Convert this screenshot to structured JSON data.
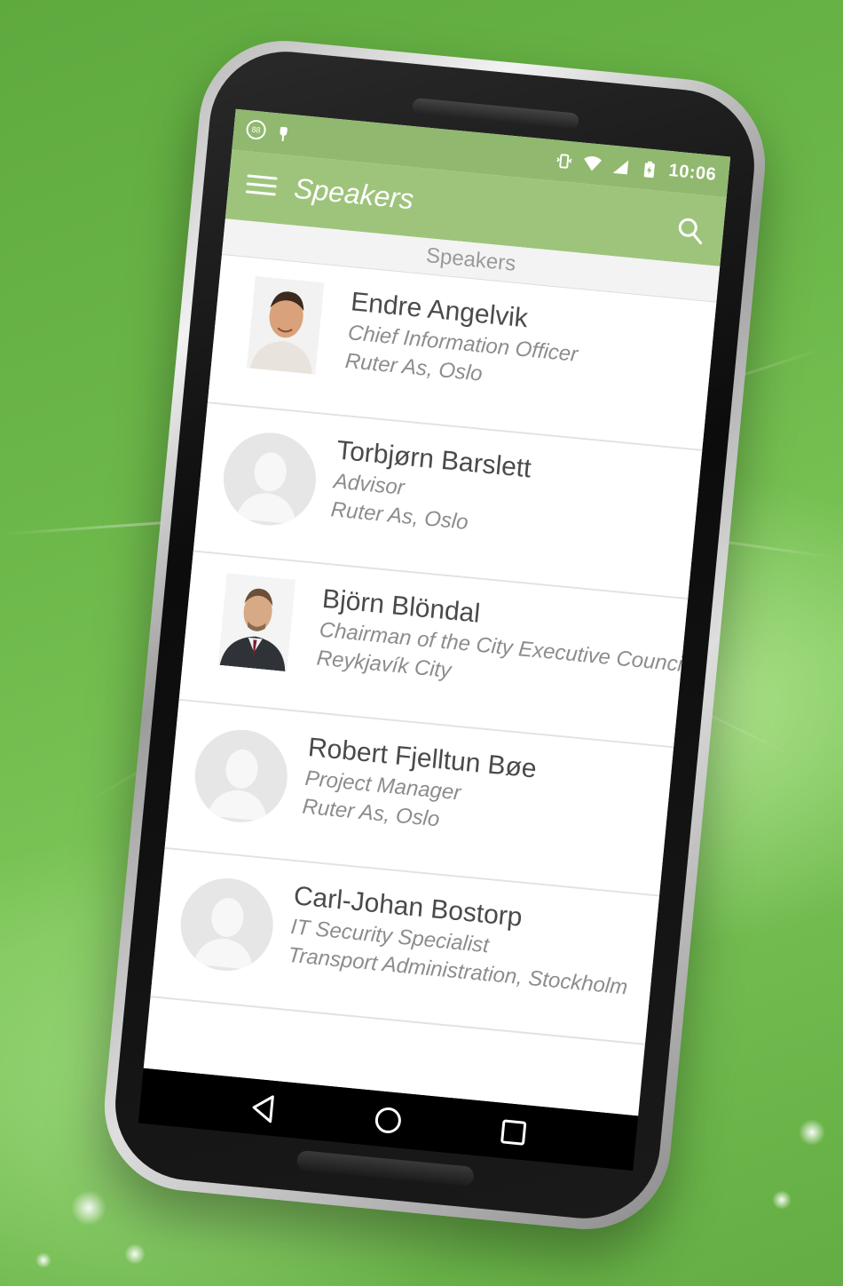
{
  "status_bar": {
    "time": "10:06",
    "icons": [
      "notification-icon",
      "usb-icon",
      "vibrate-icon",
      "wifi-icon",
      "signal-icon",
      "battery-icon"
    ]
  },
  "app_bar": {
    "title": "Speakers",
    "menu_icon": "menu-icon",
    "search_icon": "search-icon",
    "color": "#9ec47c"
  },
  "section_header": "Speakers",
  "speakers": [
    {
      "name": "Endre Angelvik",
      "role": "Chief Information Officer",
      "org": "Ruter As, Oslo",
      "avatar": "photo"
    },
    {
      "name": "Torbjørn Barslett",
      "role": "Advisor",
      "org": "Ruter As, Oslo",
      "avatar": "placeholder"
    },
    {
      "name": "Björn Blöndal",
      "role": "Chairman of the City Executive Council",
      "org": "Reykjavík City",
      "avatar": "photo"
    },
    {
      "name": "Robert Fjelltun Bøe",
      "role": "Project Manager",
      "org": "Ruter As, Oslo",
      "avatar": "placeholder"
    },
    {
      "name": "Carl-Johan Bostorp",
      "role": "IT Security Specialist",
      "org": "Transport Administration, Stockholm",
      "avatar": "placeholder"
    }
  ],
  "nav_bar": {
    "buttons": [
      "back-icon",
      "home-icon",
      "recents-icon"
    ]
  }
}
